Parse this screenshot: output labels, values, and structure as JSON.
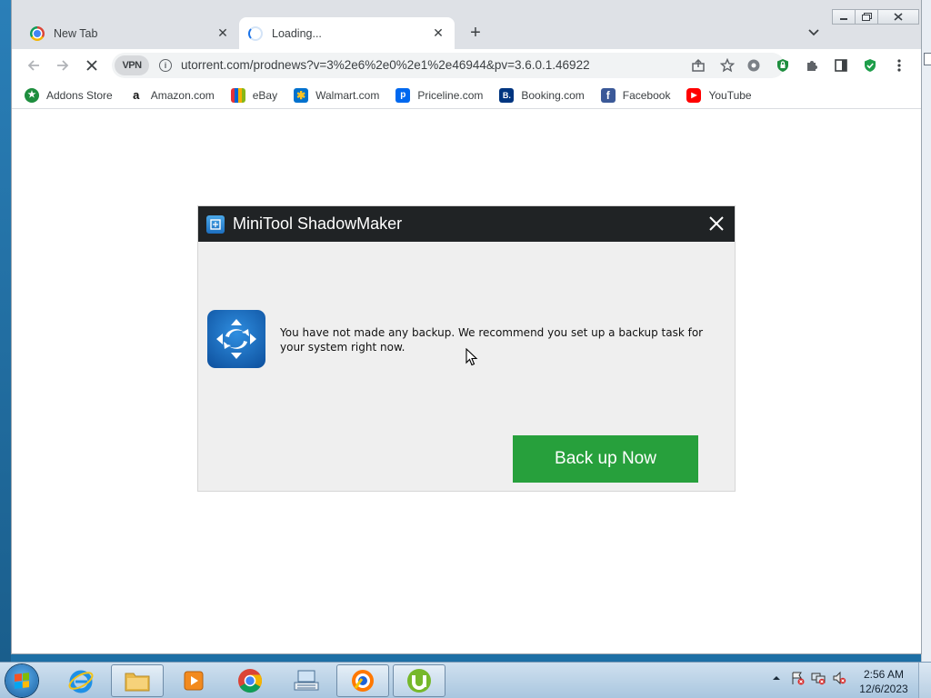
{
  "browser": {
    "tabs": [
      {
        "title": "New Tab",
        "icon": "chrome-icon",
        "active": false
      },
      {
        "title": "Loading...",
        "icon": "spinner-icon",
        "active": true
      }
    ],
    "tab_close_glyph": "✕",
    "new_tab_glyph": "+",
    "address_bar": {
      "vpn_label": "VPN",
      "url": "utorrent.com/prodnews?v=3%2e6%2e0%2e1%2e46944&pv=3.6.0.1.46922"
    },
    "bookmarks": [
      {
        "label": "Addons Store",
        "icon": "addons-store-icon",
        "color": "#1e8e3e",
        "glyph": "★"
      },
      {
        "label": "Amazon.com",
        "icon": "amazon-icon",
        "color": "#ffffff",
        "glyph": "a"
      },
      {
        "label": "eBay",
        "icon": "ebay-icon",
        "color": "#f5af02",
        "glyph": "e"
      },
      {
        "label": "Walmart.com",
        "icon": "walmart-icon",
        "color": "#0071ce",
        "glyph": "✱"
      },
      {
        "label": "Priceline.com",
        "icon": "priceline-icon",
        "color": "#0068ef",
        "glyph": "p"
      },
      {
        "label": "Booking.com",
        "icon": "booking-icon",
        "color": "#003580",
        "glyph": "B."
      },
      {
        "label": "Facebook",
        "icon": "facebook-icon",
        "color": "#3b5998",
        "glyph": "f"
      },
      {
        "label": "YouTube",
        "icon": "youtube-icon",
        "color": "#ff0000",
        "glyph": "▶"
      }
    ]
  },
  "dialog": {
    "title": "MiniTool ShadowMaker",
    "message": "You have not made any backup. We recommend you set up a backup task for your system right now.",
    "button_label": "Back up Now",
    "button_color": "#27a03c"
  },
  "taskbar": {
    "apps": [
      "internet-explorer-icon",
      "file-explorer-icon",
      "media-player-icon",
      "chrome-icon",
      "keyboard-app-icon",
      "avast-browser-icon",
      "utorrent-icon"
    ],
    "clock": {
      "time": "2:56 AM",
      "date": "12/6/2023"
    }
  }
}
